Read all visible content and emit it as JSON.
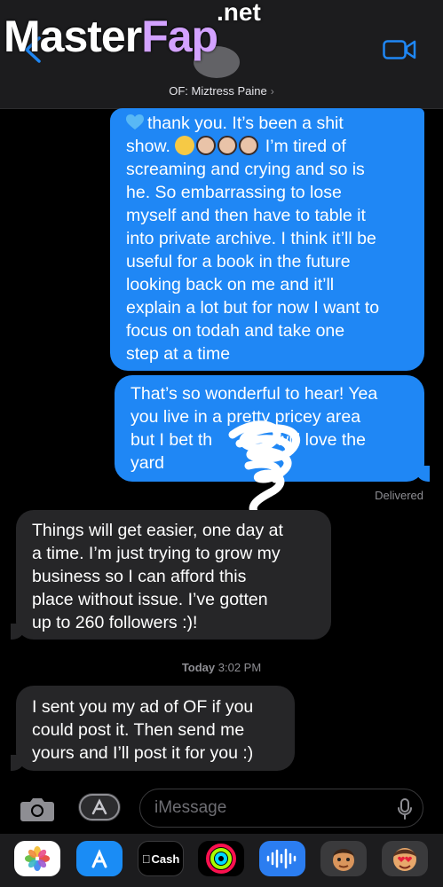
{
  "watermark": {
    "part1": "Master",
    "part2": "Fap",
    "suffix": ".net"
  },
  "header": {
    "contact_name": "OF: Miztress Paine",
    "chevron": "›"
  },
  "messages": [
    {
      "direction": "sent",
      "lines": [
        "thank you. It’s been a shit",
        "show.",
        "I’m tired of",
        "screaming and crying and so is",
        "he. So embarrassing to lose",
        "myself and then have to table it",
        "into private archive. I think it’ll be",
        "useful for a book in the future",
        "looking back on me and it’ll",
        "explain a lot but for now I want to",
        "focus on todah and take one",
        "step at a time"
      ]
    },
    {
      "direction": "sent",
      "lines": [
        "That’s so wonderful to hear! Yea",
        "you live in a pretty pricey area",
        "but I bet th",
        "will love the",
        "yard"
      ]
    },
    {
      "direction": "received",
      "lines": [
        "Things will get easier, one day at",
        "a time. I’m just trying to grow my",
        "business so I can afford this",
        "place without issue. I’ve gotten",
        "up to 260 followers :)!"
      ]
    },
    {
      "direction": "received",
      "lines": [
        "I sent you my ad of OF if you",
        "could post it. Then send me",
        "yours and I’ll post it for you :)"
      ]
    }
  ],
  "status": {
    "delivered": "Delivered"
  },
  "timestamp": {
    "day": "Today",
    "time": "3:02 PM"
  },
  "input": {
    "placeholder": "iMessage"
  },
  "apps": {
    "cash_label": "Cash"
  },
  "colors": {
    "sent": "#1f87f5",
    "received": "#262628",
    "header": "#1c1c1e"
  }
}
